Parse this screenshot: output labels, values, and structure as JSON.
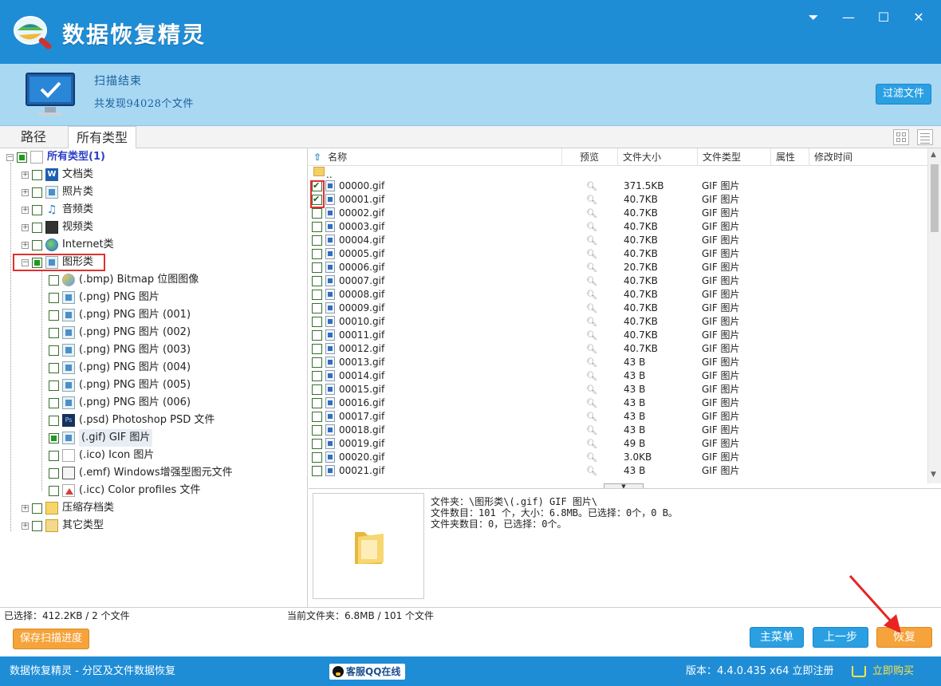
{
  "app": {
    "title": "数据恢复精灵",
    "window_controls": {
      "menu": "⏷",
      "minimize": "—",
      "maximize": "☐",
      "close": "✕"
    }
  },
  "banner": {
    "scan_title": "扫描结束",
    "scan_count": "共发现94028个文件",
    "filter_button": "过滤文件"
  },
  "tabs": [
    {
      "label": "路径",
      "active": false
    },
    {
      "label": "所有类型",
      "active": true
    }
  ],
  "tree": {
    "root": {
      "label": "所有类型(1)"
    },
    "items": [
      {
        "label": "文档类",
        "icon": "word-doc-icon"
      },
      {
        "label": "照片类",
        "icon": "photo-icon"
      },
      {
        "label": "音频类",
        "icon": "music-note-icon"
      },
      {
        "label": "视频类",
        "icon": "film-icon"
      },
      {
        "label": "Internet类",
        "icon": "globe-icon"
      },
      {
        "label": "图形类",
        "icon": "graphics-icon",
        "expanded": true,
        "highlighted": true
      }
    ],
    "graphics_children": [
      {
        "label": "(.bmp) Bitmap 位图图像",
        "icon": "bmp-icon"
      },
      {
        "label": "(.png) PNG 图片",
        "icon": "image-file-icon"
      },
      {
        "label": "(.png) PNG 图片 (001)",
        "icon": "image-file-icon"
      },
      {
        "label": "(.png) PNG 图片 (002)",
        "icon": "image-file-icon"
      },
      {
        "label": "(.png) PNG 图片 (003)",
        "icon": "image-file-icon"
      },
      {
        "label": "(.png) PNG 图片 (004)",
        "icon": "image-file-icon"
      },
      {
        "label": "(.png) PNG 图片 (005)",
        "icon": "image-file-icon"
      },
      {
        "label": "(.png) PNG 图片 (006)",
        "icon": "image-file-icon"
      },
      {
        "label": "(.psd) Photoshop PSD 文件",
        "icon": "psd-icon"
      },
      {
        "label": "(.gif) GIF 图片",
        "icon": "image-file-icon",
        "selected": true
      },
      {
        "label": "(.ico) Icon 图片",
        "icon": "blank-file-icon"
      },
      {
        "label": "(.emf) Windows增强型图元文件",
        "icon": "emf-icon"
      },
      {
        "label": "(.icc) Color profiles 文件",
        "icon": "icc-icon"
      }
    ],
    "after_items": [
      {
        "label": "压缩存档类",
        "icon": "archive-icon"
      },
      {
        "label": "其它类型",
        "icon": "other-type-icon"
      }
    ]
  },
  "file_list": {
    "columns": [
      "名称",
      "预览",
      "文件大小",
      "文件类型",
      "属性",
      "修改时间"
    ],
    "parent_row": "..",
    "rows": [
      {
        "name": "00000.gif",
        "size": "371.5KB",
        "type": "GIF 图片",
        "checked": true
      },
      {
        "name": "00001.gif",
        "size": "40.7KB",
        "type": "GIF 图片",
        "checked": true
      },
      {
        "name": "00002.gif",
        "size": "40.7KB",
        "type": "GIF 图片",
        "checked": false
      },
      {
        "name": "00003.gif",
        "size": "40.7KB",
        "type": "GIF 图片",
        "checked": false
      },
      {
        "name": "00004.gif",
        "size": "40.7KB",
        "type": "GIF 图片",
        "checked": false
      },
      {
        "name": "00005.gif",
        "size": "40.7KB",
        "type": "GIF 图片",
        "checked": false
      },
      {
        "name": "00006.gif",
        "size": "20.7KB",
        "type": "GIF 图片",
        "checked": false
      },
      {
        "name": "00007.gif",
        "size": "40.7KB",
        "type": "GIF 图片",
        "checked": false
      },
      {
        "name": "00008.gif",
        "size": "40.7KB",
        "type": "GIF 图片",
        "checked": false
      },
      {
        "name": "00009.gif",
        "size": "40.7KB",
        "type": "GIF 图片",
        "checked": false
      },
      {
        "name": "00010.gif",
        "size": "40.7KB",
        "type": "GIF 图片",
        "checked": false
      },
      {
        "name": "00011.gif",
        "size": "40.7KB",
        "type": "GIF 图片",
        "checked": false
      },
      {
        "name": "00012.gif",
        "size": "40.7KB",
        "type": "GIF 图片",
        "checked": false
      },
      {
        "name": "00013.gif",
        "size": "43 B",
        "type": "GIF 图片",
        "checked": false
      },
      {
        "name": "00014.gif",
        "size": "43 B",
        "type": "GIF 图片",
        "checked": false
      },
      {
        "name": "00015.gif",
        "size": "43 B",
        "type": "GIF 图片",
        "checked": false
      },
      {
        "name": "00016.gif",
        "size": "43 B",
        "type": "GIF 图片",
        "checked": false
      },
      {
        "name": "00017.gif",
        "size": "43 B",
        "type": "GIF 图片",
        "checked": false
      },
      {
        "name": "00018.gif",
        "size": "43 B",
        "type": "GIF 图片",
        "checked": false
      },
      {
        "name": "00019.gif",
        "size": "49 B",
        "type": "GIF 图片",
        "checked": false
      },
      {
        "name": "00020.gif",
        "size": "3.0KB",
        "type": "GIF 图片",
        "checked": false
      },
      {
        "name": "00021.gif",
        "size": "43 B",
        "type": "GIF 图片",
        "checked": false
      }
    ]
  },
  "info": {
    "line1": "文件夹：\\图形类\\(.gif) GIF 图片\\",
    "line2": "文件数目：101 个，大小：6.8MB。已选择：0个，0 B。",
    "line3": "文件夹数目：0，已选择：0个。"
  },
  "selection": {
    "selected": "已选择：412.2KB / 2 个文件",
    "current_folder": "当前文件夹：6.8MB / 101 个文件"
  },
  "actions": {
    "save_progress": "保存扫描进度",
    "main_menu": "主菜单",
    "previous": "上一步",
    "recover": "恢复"
  },
  "status": {
    "app_desc": "数据恢复精灵 - 分区及文件数据恢复",
    "qq_online": "客服QQ在线",
    "version": "版本：4.4.0.435 x64  立即注册",
    "buy_now": "立即购买"
  },
  "colors": {
    "title_bar": "#1f8dd6",
    "banner": "#a9d8f3",
    "accent_blue": "#2aa0e3",
    "accent_orange": "#f5a33a",
    "highlight_red": "#e03030"
  }
}
